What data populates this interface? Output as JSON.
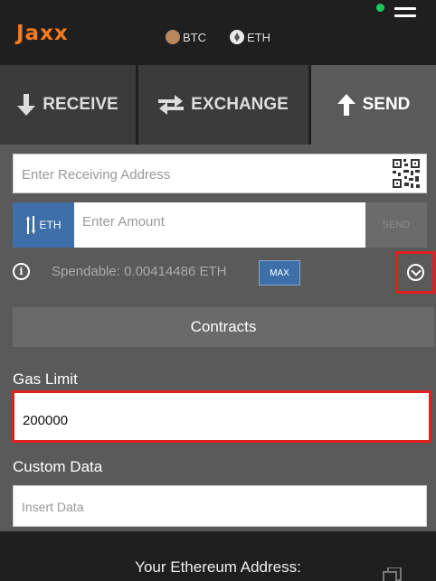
{
  "header": {
    "logo": "Jaxx",
    "coins": [
      {
        "label": "BTC",
        "icon": "bitcoin-icon"
      },
      {
        "label": "ETH",
        "icon": "ethereum-icon"
      }
    ]
  },
  "tabs": [
    {
      "label": "RECEIVE",
      "icon": "arrow-down-icon"
    },
    {
      "label": "EXCHANGE",
      "icon": "exchange-arrows-icon"
    },
    {
      "label": "SEND",
      "icon": "arrow-up-icon",
      "active": true
    }
  ],
  "send_form": {
    "address_placeholder": "Enter Receiving Address",
    "currency_label": "ETH",
    "amount_placeholder": "Enter Amount",
    "send_label": "SEND",
    "spendable_text": "Spendable: 0.00414486 ETH",
    "max_label": "MAX",
    "contracts_label": "Contracts",
    "gas_limit_label": "Gas Limit",
    "gas_limit_value": "200000",
    "custom_data_label": "Custom Data",
    "custom_data_placeholder": "Insert Data"
  },
  "footer": {
    "address_title": "Your Ethereum Address:"
  },
  "colors": {
    "accent": "#f47b20",
    "primary_button": "#3f6fa8",
    "highlight": "#e01f1f",
    "background": "#5a5a5a",
    "dark": "#1f1f1f"
  }
}
